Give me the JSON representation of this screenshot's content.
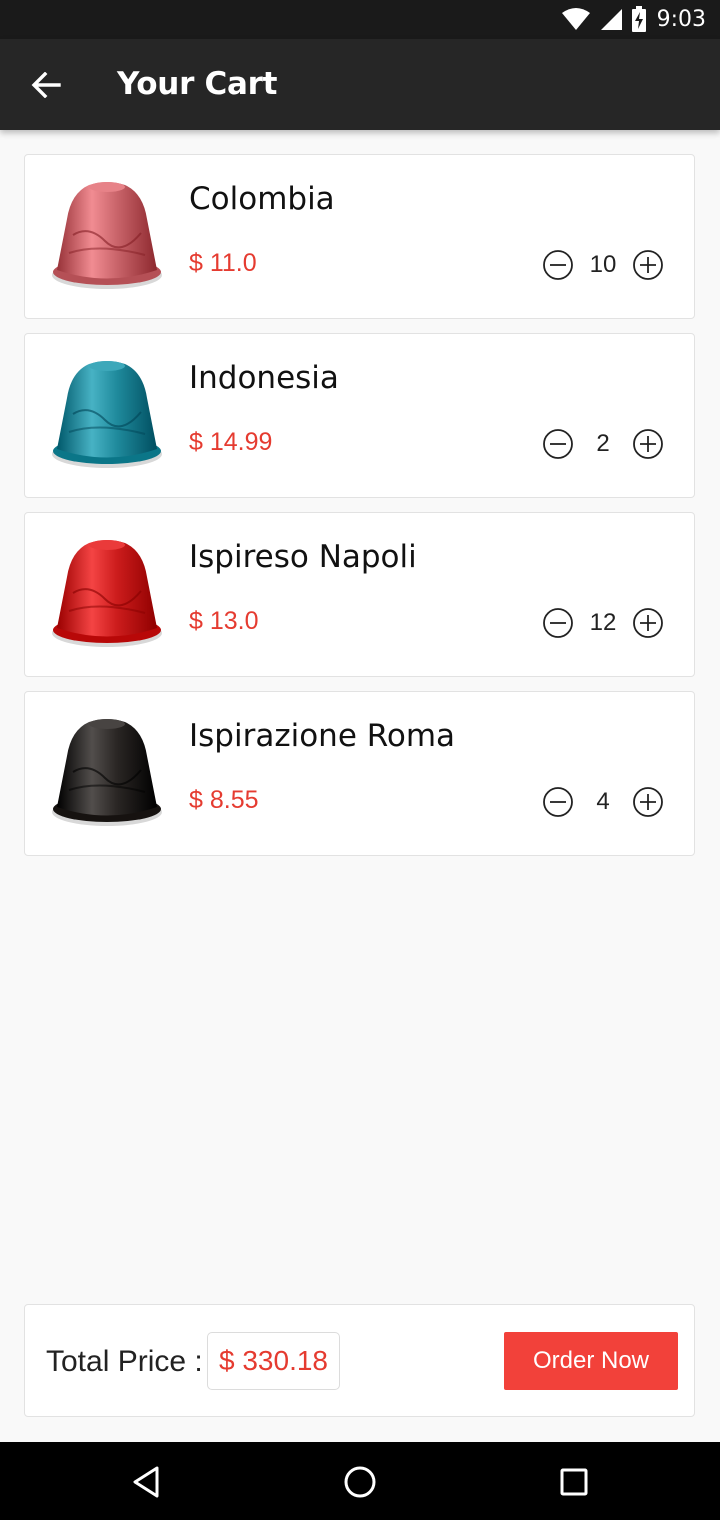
{
  "status_bar": {
    "time": "9:03",
    "icons": [
      "wifi-icon",
      "signal-icon",
      "battery-charging-icon"
    ]
  },
  "app_bar": {
    "title": "Your Cart",
    "back_icon": "arrow-back-icon"
  },
  "cart": {
    "items": [
      {
        "name": "Colombia",
        "price": "$ 11.0",
        "quantity": "10",
        "capsule_color": "#c9646a"
      },
      {
        "name": "Indonesia",
        "price": "$ 14.99",
        "quantity": "2",
        "capsule_color": "#1f8a9c"
      },
      {
        "name": "Ispireso Napoli",
        "price": "$ 13.0",
        "quantity": "12",
        "capsule_color": "#cc1c1c"
      },
      {
        "name": "Ispirazione Roma",
        "price": "$ 8.55",
        "quantity": "4",
        "capsule_color": "#2a2624"
      }
    ]
  },
  "footer": {
    "total_label": "Total Price :",
    "total_value": "$ 330.18",
    "order_button": "Order Now"
  },
  "nav_bar": {
    "icons": [
      "back-triangle-icon",
      "home-circle-icon",
      "recents-square-icon"
    ]
  },
  "colors": {
    "accent": "#f2413a",
    "price": "#e53b30",
    "app_bar": "#262626"
  }
}
